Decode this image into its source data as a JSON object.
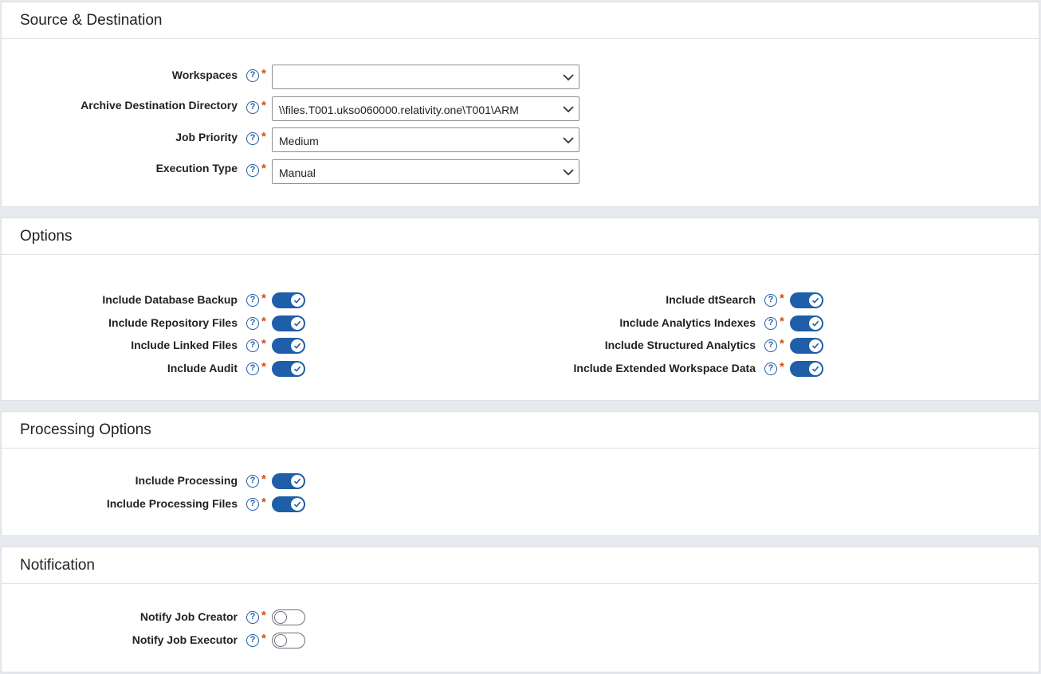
{
  "sections": {
    "source_destination": {
      "title": "Source & Destination",
      "fields": {
        "workspaces": {
          "label": "Workspaces",
          "value": ""
        },
        "archive_dir": {
          "label": "Archive Destination Directory",
          "value": "\\\\files.T001.ukso060000.relativity.one\\T001\\ARM"
        },
        "job_priority": {
          "label": "Job Priority",
          "value": "Medium"
        },
        "execution_type": {
          "label": "Execution Type",
          "value": "Manual"
        }
      }
    },
    "options": {
      "title": "Options",
      "left": [
        {
          "label": "Include Database Backup",
          "on": true
        },
        {
          "label": "Include Repository Files",
          "on": true
        },
        {
          "label": "Include Linked Files",
          "on": true
        },
        {
          "label": "Include Audit",
          "on": true
        }
      ],
      "right": [
        {
          "label": "Include dtSearch",
          "on": true
        },
        {
          "label": "Include Analytics Indexes",
          "on": true
        },
        {
          "label": "Include Structured Analytics",
          "on": true
        },
        {
          "label": "Include Extended Workspace Data",
          "on": true
        }
      ]
    },
    "processing": {
      "title": "Processing Options",
      "items": [
        {
          "label": "Include Processing",
          "on": true
        },
        {
          "label": "Include Processing Files",
          "on": true
        }
      ]
    },
    "notification": {
      "title": "Notification",
      "items": [
        {
          "label": "Notify Job Creator",
          "on": false
        },
        {
          "label": "Notify Job Executor",
          "on": false
        }
      ]
    }
  },
  "common": {
    "help_glyph": "?",
    "required_mark": "*"
  },
  "colors": {
    "accent": "#1f5ea8",
    "required": "#d9480f"
  }
}
